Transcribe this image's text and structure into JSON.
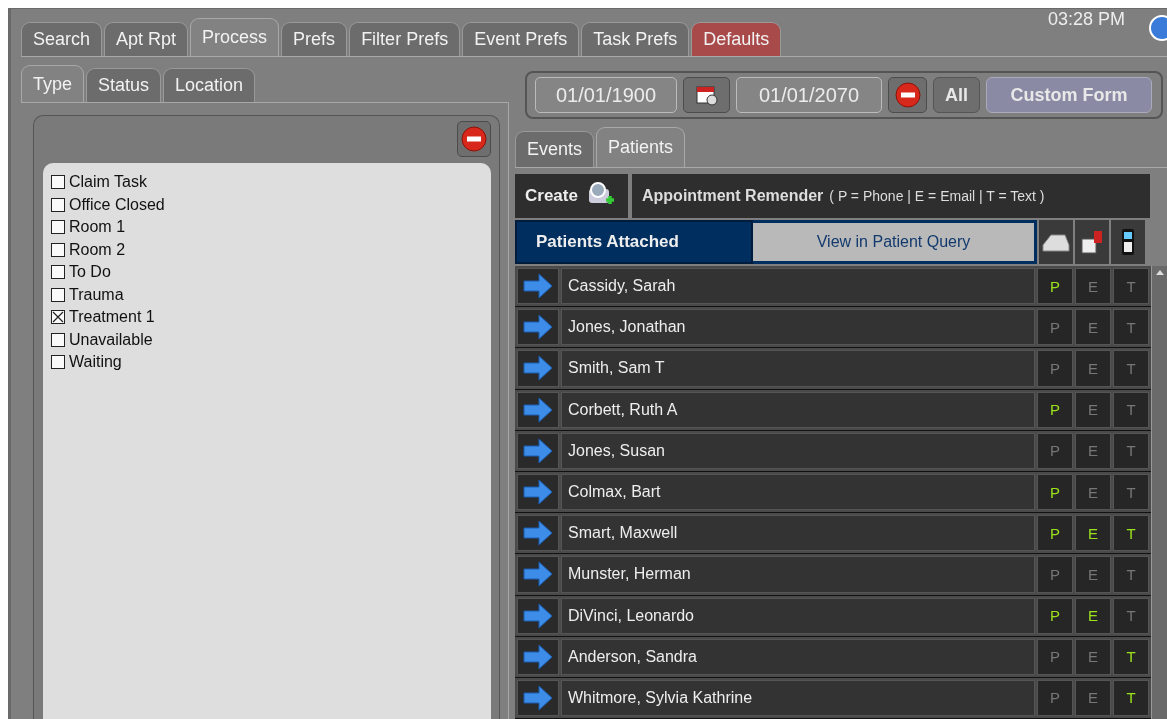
{
  "main_tabs": [
    {
      "label": "Search",
      "selected": false,
      "kind": "normal"
    },
    {
      "label": "Apt Rpt",
      "selected": false,
      "kind": "normal"
    },
    {
      "label": "Process",
      "selected": true,
      "kind": "normal"
    },
    {
      "label": "Prefs",
      "selected": false,
      "kind": "normal"
    },
    {
      "label": "Filter Prefs",
      "selected": false,
      "kind": "normal"
    },
    {
      "label": "Event Prefs",
      "selected": false,
      "kind": "normal"
    },
    {
      "label": "Task Prefs",
      "selected": false,
      "kind": "normal"
    },
    {
      "label": "Defaults",
      "selected": false,
      "kind": "alert"
    }
  ],
  "clock": "03:28 PM",
  "filter_tabs": [
    {
      "label": "Type",
      "selected": true
    },
    {
      "label": "Status",
      "selected": false
    },
    {
      "label": "Location",
      "selected": false
    }
  ],
  "types": [
    {
      "label": "Claim Task",
      "checked": false
    },
    {
      "label": "Office Closed",
      "checked": false
    },
    {
      "label": "Room 1",
      "checked": false
    },
    {
      "label": "Room 2",
      "checked": false
    },
    {
      "label": "To Do",
      "checked": false
    },
    {
      "label": "Trauma",
      "checked": false
    },
    {
      "label": "Treatment 1",
      "checked": true
    },
    {
      "label": "Unavailable",
      "checked": false
    },
    {
      "label": "Waiting",
      "checked": false
    }
  ],
  "date_bar": {
    "start": "01/01/1900",
    "end": "01/01/2070",
    "all": "All",
    "custom_form": "Custom Form"
  },
  "view_tabs": [
    {
      "label": "Events",
      "selected": false
    },
    {
      "label": "Patients",
      "selected": true
    }
  ],
  "create": "Create",
  "reminder_title": "Appointment Remender",
  "reminder_legend": "( P = Phone | E = Email | T = Text )",
  "patients_attached": "Patients Attached",
  "view_query": "View in Patient Query",
  "patients": [
    {
      "name": "Cassidy, Sarah",
      "phone": {
        "label": "P",
        "on": true
      },
      "email": {
        "label": "E",
        "on": false
      },
      "text": {
        "label": "T",
        "on": false
      }
    },
    {
      "name": "Jones, Jonathan",
      "phone": {
        "label": "P",
        "on": false
      },
      "email": {
        "label": "E",
        "on": false
      },
      "text": {
        "label": "T",
        "on": false
      }
    },
    {
      "name": "Smith, Sam T",
      "phone": {
        "label": "P",
        "on": false
      },
      "email": {
        "label": "E",
        "on": false
      },
      "text": {
        "label": "T",
        "on": false
      }
    },
    {
      "name": "Corbett, Ruth A",
      "phone": {
        "label": "P",
        "on": true
      },
      "email": {
        "label": "E",
        "on": false
      },
      "text": {
        "label": "T",
        "on": false
      }
    },
    {
      "name": "Jones, Susan",
      "phone": {
        "label": "P",
        "on": false
      },
      "email": {
        "label": "E",
        "on": false
      },
      "text": {
        "label": "T",
        "on": false
      }
    },
    {
      "name": "Colmax, Bart",
      "phone": {
        "label": "P",
        "on": true
      },
      "email": {
        "label": "E",
        "on": false
      },
      "text": {
        "label": "T",
        "on": false
      }
    },
    {
      "name": "Smart, Maxwell",
      "phone": {
        "label": "P",
        "on": true
      },
      "email": {
        "label": "E",
        "on": true
      },
      "text": {
        "label": "T",
        "on": true
      }
    },
    {
      "name": "Munster, Herman",
      "phone": {
        "label": "P",
        "on": false
      },
      "email": {
        "label": "E",
        "on": false
      },
      "text": {
        "label": "T",
        "on": false
      }
    },
    {
      "name": "DiVinci, Leonardo",
      "phone": {
        "label": "P",
        "on": true
      },
      "email": {
        "label": "E",
        "on": true
      },
      "text": {
        "label": "T",
        "on": false
      }
    },
    {
      "name": "Anderson, Sandra",
      "phone": {
        "label": "P",
        "on": false
      },
      "email": {
        "label": "E",
        "on": false
      },
      "text": {
        "label": "T",
        "on": true
      }
    },
    {
      "name": "Whitmore, Sylvia Kathrine",
      "phone": {
        "label": "P",
        "on": false
      },
      "email": {
        "label": "E",
        "on": false
      },
      "text": {
        "label": "T",
        "on": true
      }
    }
  ]
}
